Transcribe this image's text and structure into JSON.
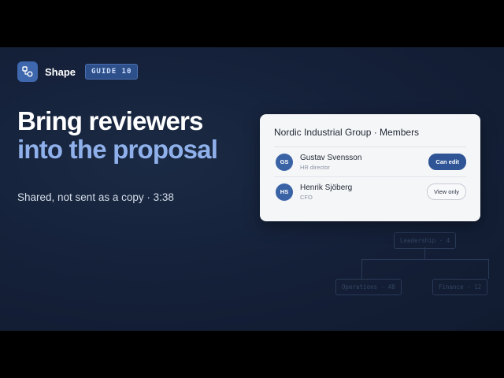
{
  "brand": {
    "name": "Shape",
    "badge": "GUIDE 10",
    "logo_icon": "shape-logo-icon"
  },
  "headline": {
    "line1": "Bring reviewers",
    "line2": "into the proposal"
  },
  "subtitle": "Shared, not sent as a copy · 3:38",
  "card": {
    "title": "Nordic Industrial Group · Members",
    "members": [
      {
        "initials": "GS",
        "name": "Gustav Svensson",
        "role": "HR director",
        "permission": "Can edit"
      },
      {
        "initials": "HS",
        "name": "Henrik Sjöberg",
        "role": "CFO",
        "permission": "View only"
      }
    ]
  },
  "orgchart": {
    "root": "Leadership · 4",
    "children": [
      "Operations · 48",
      "Finance · 12"
    ]
  },
  "colors": {
    "accent": "#3e67ad",
    "headline_highlight": "#8fb0ea",
    "primary_button": "#2f5597",
    "background": "#15213a"
  }
}
